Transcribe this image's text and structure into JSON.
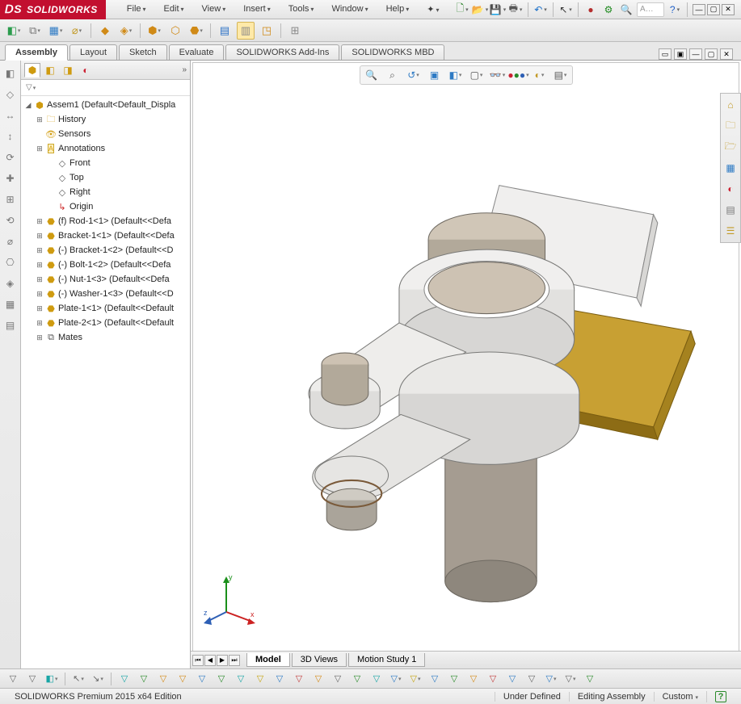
{
  "brand": {
    "name": "SOLIDWORKS"
  },
  "menus": {
    "file": "File",
    "edit": "Edit",
    "view": "View",
    "insert": "Insert",
    "tools": "Tools",
    "window": "Window",
    "help": "Help"
  },
  "searchPlaceholder": "A…",
  "commandTabs": {
    "assembly": "Assembly",
    "layout": "Layout",
    "sketch": "Sketch",
    "evaluate": "Evaluate",
    "addins": "SOLIDWORKS Add-Ins",
    "mbd": "SOLIDWORKS MBD"
  },
  "tree": {
    "root": "Assem1  (Default<Default_Displa",
    "history": "History",
    "sensors": "Sensors",
    "annotations": "Annotations",
    "front": "Front",
    "top": "Top",
    "right": "Right",
    "origin": "Origin",
    "comp1": "(f) Rod-1<1> (Default<<Defa",
    "comp2": "Bracket-1<1> (Default<<Defa",
    "comp3": "(-) Bracket-1<2> (Default<<D",
    "comp4": "(-) Bolt-1<2> (Default<<Defa",
    "comp5": "(-) Nut-1<3> (Default<<Defa",
    "comp6": "(-) Washer-1<3> (Default<<D",
    "comp7": "Plate-1<1> (Default<<Default",
    "comp8": "Plate-2<1> (Default<<Default",
    "mates": "Mates"
  },
  "viewTabs": {
    "model": "Model",
    "views3d": "3D Views",
    "motion": "Motion Study 1"
  },
  "status": {
    "product": "SOLIDWORKS Premium 2015 x64 Edition",
    "state": "Under Defined",
    "mode": "Editing Assembly",
    "units": "Custom"
  },
  "colors": {
    "brandRed": "#c20f2f",
    "brass": "#c29a27",
    "steelTop": "#cdc2b3",
    "steelSide": "#a59c91",
    "bracket": "#eae9e7",
    "bracketShade": "#cfcecc"
  }
}
